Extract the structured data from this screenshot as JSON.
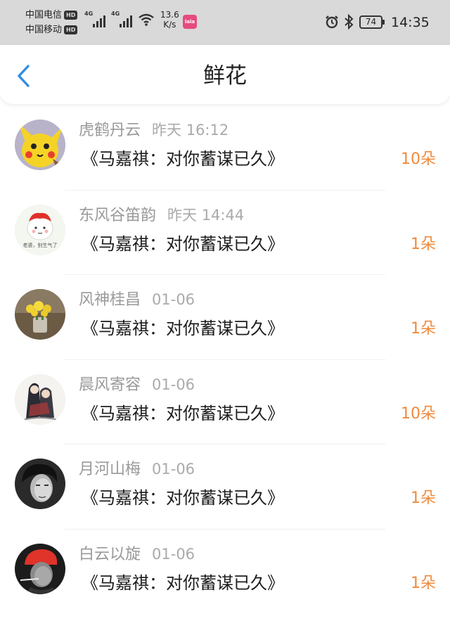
{
  "status_bar": {
    "carrier1": "中国电信",
    "carrier2": "中国移动",
    "hd_label": "HD",
    "network1": "4G",
    "network2": "4G",
    "speed_value": "13.6",
    "speed_unit": "K/s",
    "app_badge": "lala",
    "battery": "74",
    "time": "14:35"
  },
  "header": {
    "title": "鲜花"
  },
  "items": [
    {
      "name": "虎鹤丹云",
      "time": "昨天 16:12",
      "title": "《马嘉祺：对你蓄谋已久》",
      "count": "10朵"
    },
    {
      "name": "东风谷笛韵",
      "time": "昨天 14:44",
      "title": "《马嘉祺：对你蓄谋已久》",
      "count": "1朵"
    },
    {
      "name": "风神桂昌",
      "time": "01-06",
      "title": "《马嘉祺：对你蓄谋已久》",
      "count": "1朵"
    },
    {
      "name": "晨风寄容",
      "time": "01-06",
      "title": "《马嘉祺：对你蓄谋已久》",
      "count": "10朵"
    },
    {
      "name": "月河山梅",
      "time": "01-06",
      "title": "《马嘉祺：对你蓄谋已久》",
      "count": "1朵"
    },
    {
      "name": "白云以旋",
      "time": "01-06",
      "title": "《马嘉祺：对你蓄谋已久》",
      "count": "1朵"
    }
  ],
  "avatar2_caption": "老婆，别生气了",
  "colors": {
    "accent_blue": "#2f8fe0",
    "count_orange": "#f08a3c",
    "status_bar_bg": "#d9d9d9"
  }
}
